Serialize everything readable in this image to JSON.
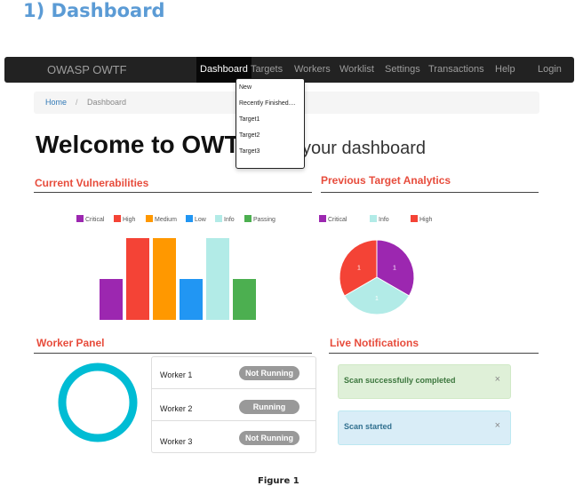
{
  "document": {
    "heading": "1) Dashboard",
    "caption": "Figure 1"
  },
  "navbar": {
    "brand": "OWASP OWTF",
    "items": [
      {
        "label": "Dashboard"
      },
      {
        "label": "Targets"
      },
      {
        "label": "Workers"
      },
      {
        "label": "Worklist"
      },
      {
        "label": "Settings"
      },
      {
        "label": "Transactions"
      },
      {
        "label": "Help"
      },
      {
        "label": "Login"
      }
    ],
    "active": "Dashboard"
  },
  "targets_dropdown": {
    "items": [
      "New",
      "Recently Finished....",
      "Target1",
      "Target2",
      "Target3"
    ]
  },
  "breadcrumb": {
    "home": "Home",
    "separator": "/",
    "current": "Dashboard"
  },
  "page": {
    "title": "Welcome to OWTF",
    "subtitle": "your dashboard"
  },
  "current_vulnerabilities": {
    "title": "Current Vulnerabilities",
    "legend": [
      {
        "label": "Critical",
        "color": "#9c27b0"
      },
      {
        "label": "High",
        "color": "#f44336"
      },
      {
        "label": "Medium",
        "color": "#ff9800"
      },
      {
        "label": "Low",
        "color": "#2196f3"
      },
      {
        "label": "Info",
        "color": "#b2ebe7"
      },
      {
        "label": "Passing",
        "color": "#4caf50"
      }
    ]
  },
  "previous_target_analytics": {
    "title": "Previous Target Analytics",
    "legend": [
      {
        "label": "Critical",
        "color": "#9c27b0"
      },
      {
        "label": "Info",
        "color": "#b2ebe7"
      },
      {
        "label": "High",
        "color": "#f44336"
      }
    ]
  },
  "worker_panel": {
    "title": "Worker Panel",
    "ring_color": "#00bcd4",
    "workers": [
      {
        "name": "Worker 1",
        "status": "Not Running"
      },
      {
        "name": "Worker 2",
        "status": "Running"
      },
      {
        "name": "Worker 3",
        "status": "Not Running"
      }
    ]
  },
  "live_notifications": {
    "title": "Live Notifications",
    "alerts": [
      {
        "text": "Scan successfully completed",
        "close": "×",
        "type": "success"
      },
      {
        "text": "Scan started",
        "close": "×",
        "type": "info"
      }
    ]
  },
  "chart_data": [
    {
      "type": "bar",
      "categories": [
        "Critical",
        "High",
        "Medium",
        "Low",
        "Info",
        "Passing"
      ],
      "values": [
        1,
        2,
        2,
        1,
        2,
        1
      ],
      "colors": [
        "#9c27b0",
        "#f44336",
        "#ff9800",
        "#2196f3",
        "#b2ebe7",
        "#4caf50"
      ],
      "ylim": [
        0,
        2
      ],
      "grid": false,
      "legend": "top"
    },
    {
      "type": "pie",
      "categories": [
        "Critical",
        "Info",
        "High"
      ],
      "values": [
        1,
        1,
        1
      ],
      "labels": [
        "1",
        "1",
        "1"
      ],
      "colors": [
        "#9c27b0",
        "#b2ebe7",
        "#f44336"
      ],
      "legend": "top"
    }
  ]
}
